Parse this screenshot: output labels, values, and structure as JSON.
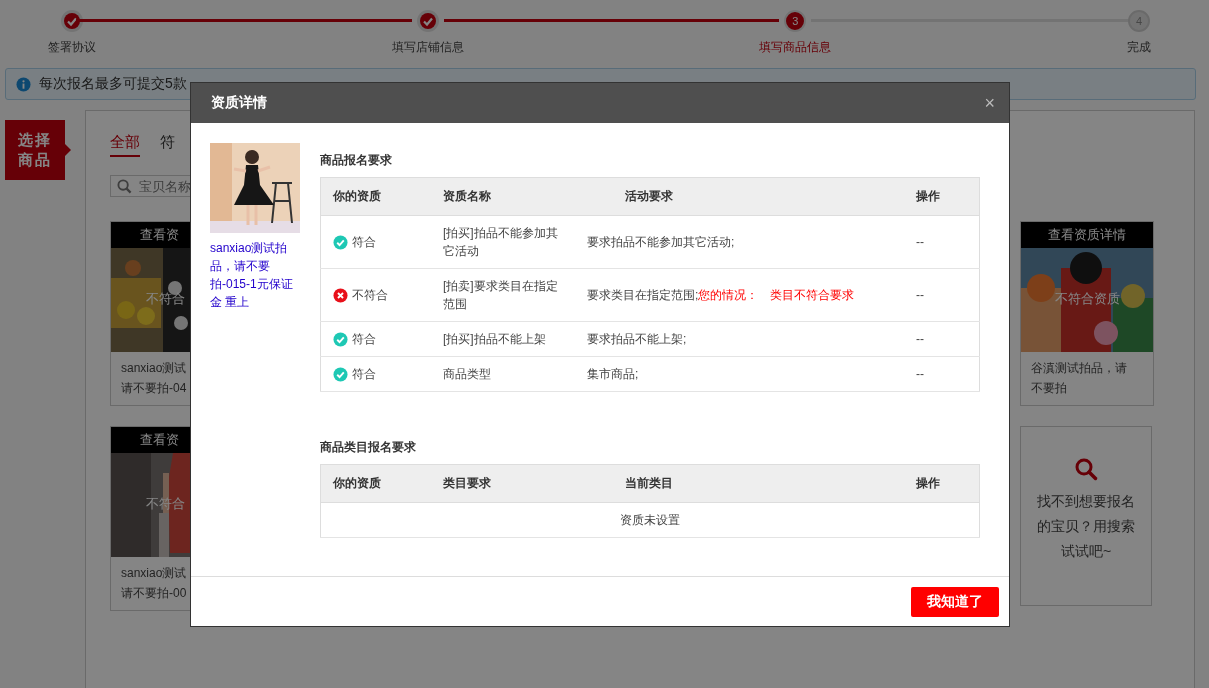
{
  "steps": [
    {
      "label": "签署协议",
      "done": true,
      "current": false
    },
    {
      "label": "填写店铺信息",
      "done": true,
      "current": false
    },
    {
      "label": "填写商品信息",
      "done": false,
      "current": true,
      "number": "3"
    },
    {
      "label": "完成",
      "done": false,
      "current": false,
      "number": "4"
    }
  ],
  "notice": {
    "text": "每次报名最多可提交5款"
  },
  "side_tag": "选择商品",
  "tabs": [
    {
      "label": "全部",
      "selected": true
    },
    {
      "label": "符",
      "selected": false
    }
  ],
  "search": {
    "placeholder": "宝贝名称"
  },
  "left_cards": [
    {
      "header": "查看资",
      "badge": "不符合",
      "lines": [
        "sanxiao测试",
        "请不要拍-04"
      ]
    },
    {
      "header": "查看资",
      "badge": "不符合",
      "lines": [
        "sanxiao测试",
        "请不要拍-00"
      ]
    }
  ],
  "right_cards": [
    {
      "header": "查看资质详情",
      "badge": "不符合资质",
      "lines": [
        "谷滇测试拍品，请",
        "不要拍"
      ]
    }
  ],
  "search_card": {
    "text": "找不到想要报名的宝贝？用搜索试试吧~"
  },
  "modal": {
    "title": "资质详情",
    "close": "×",
    "product": {
      "title": "sanxiao测试拍品，请不要拍-015-1元保证金 重上"
    },
    "sections": [
      {
        "title": "商品报名要求",
        "columns": [
          "你的资质",
          "资质名称",
          "活动要求",
          "操作"
        ],
        "rows": [
          {
            "passed": true,
            "status_label": "符合",
            "name": "[拍买]拍品不能参加其它活动",
            "requirement": "要求拍品不能参加其它活动;",
            "action": "--"
          },
          {
            "passed": false,
            "status_label": "不符合",
            "name": "[拍卖]要求类目在指定范围",
            "requirement": "要求类目在指定范围;",
            "note_label": "您的情况：",
            "note_value": "类目不符合要求",
            "action": "--"
          },
          {
            "passed": true,
            "status_label": "符合",
            "name": "[拍买]拍品不能上架",
            "requirement": "要求拍品不能上架;",
            "action": "--"
          },
          {
            "passed": true,
            "status_label": "符合",
            "name": "商品类型",
            "requirement": "集市商品;",
            "action": "--"
          }
        ]
      },
      {
        "title": "商品类目报名要求",
        "columns": [
          "你的资质",
          "类目要求",
          "当前类目",
          "操作"
        ],
        "empty": "资质未设置"
      }
    ],
    "button": "我知道了"
  }
}
